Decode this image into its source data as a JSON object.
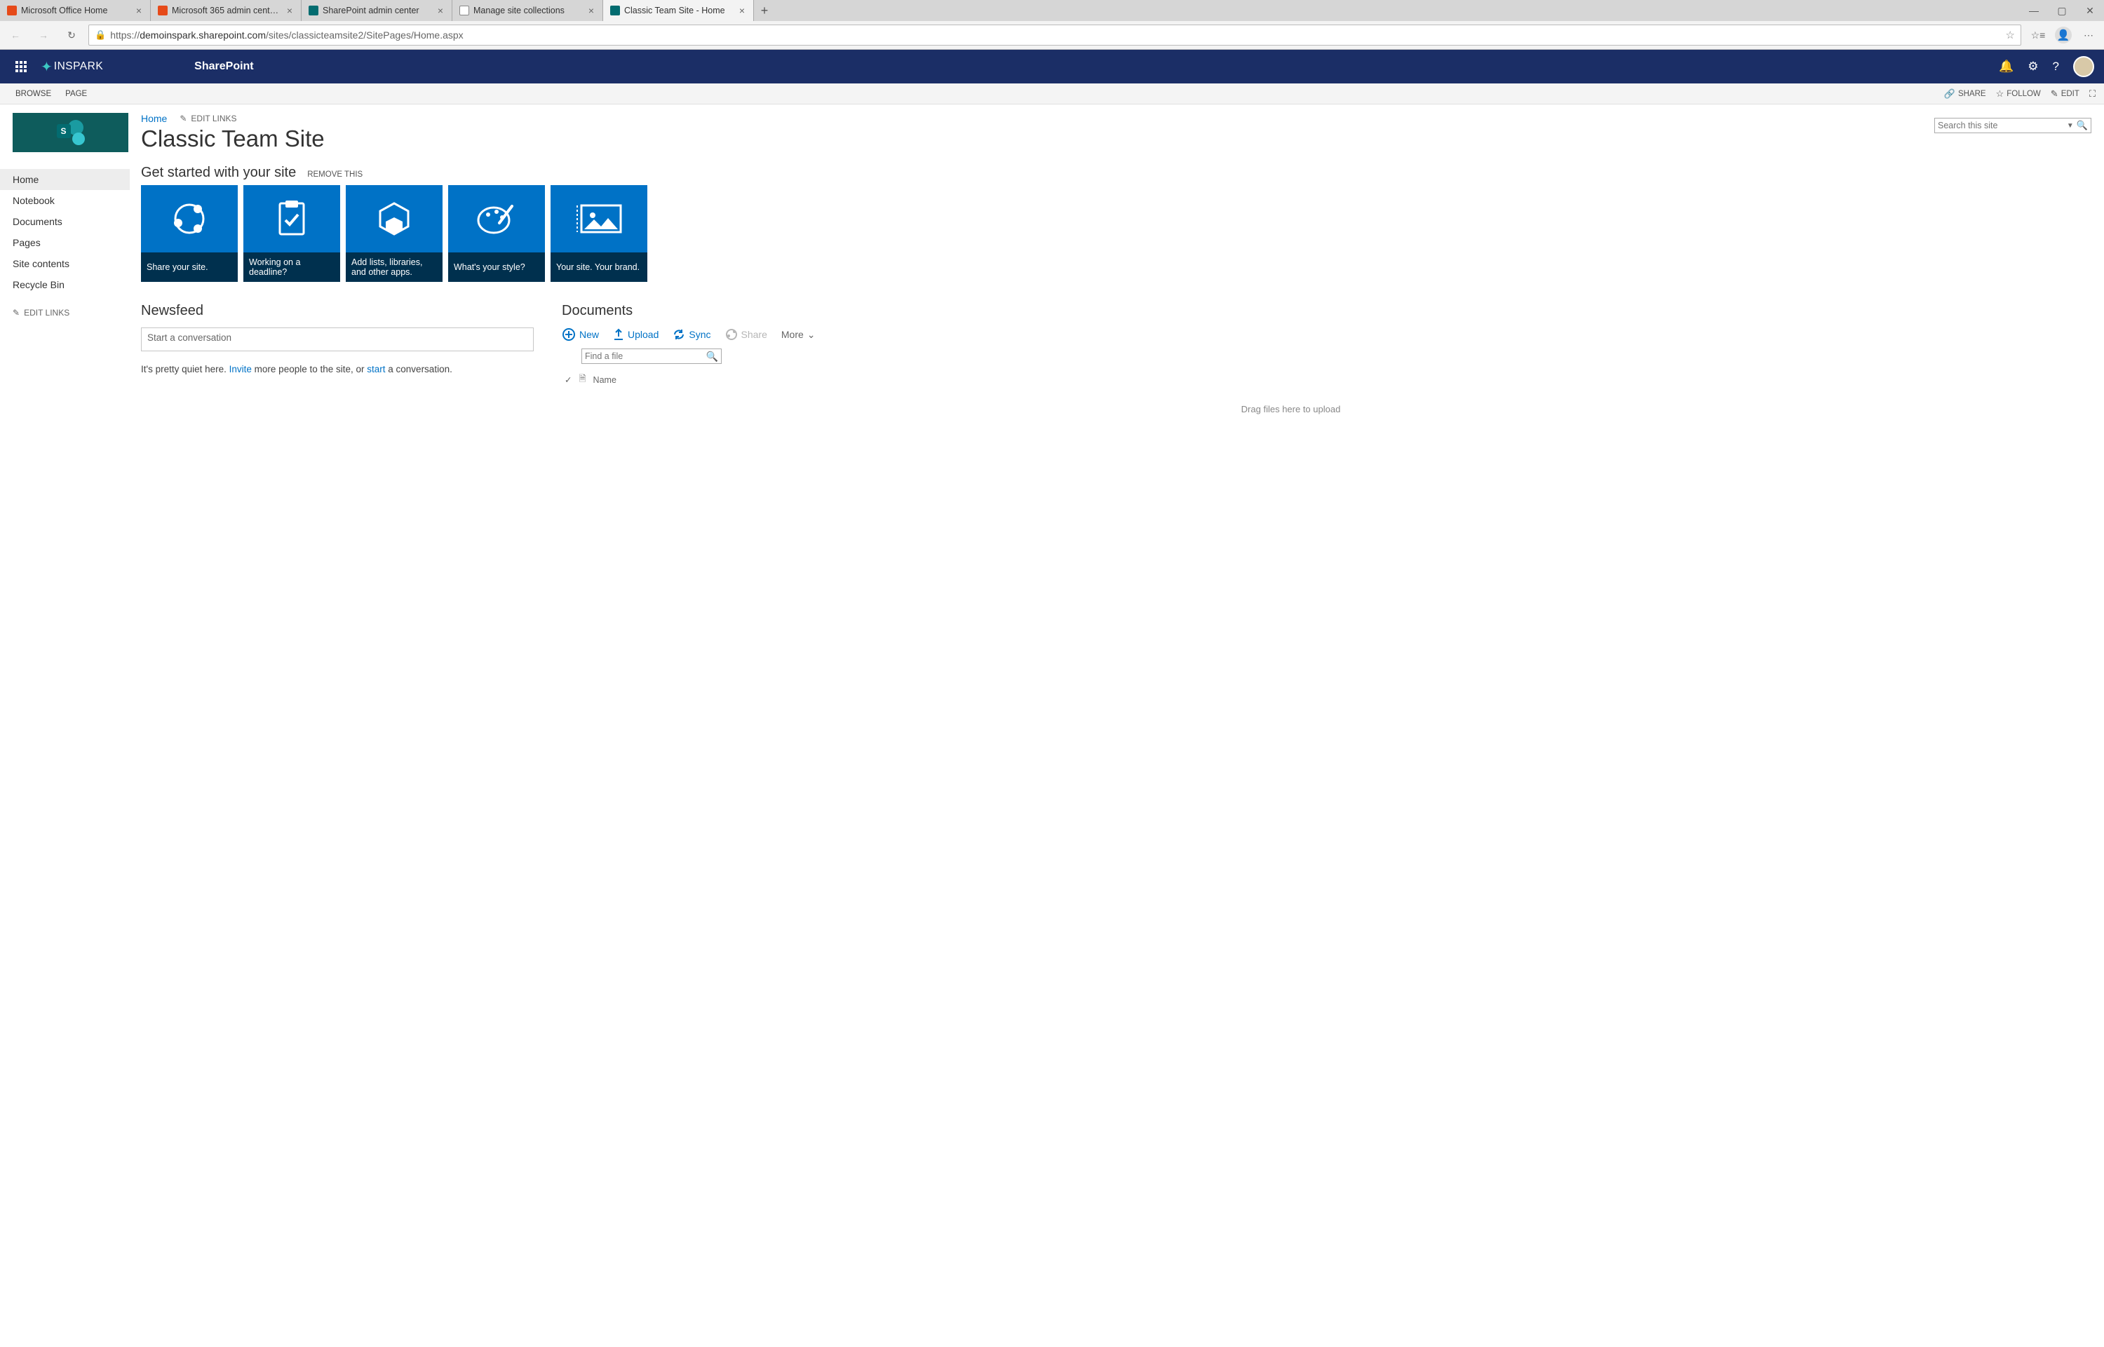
{
  "browser": {
    "tabs": [
      {
        "title": "Microsoft Office Home",
        "favicon": "office"
      },
      {
        "title": "Microsoft 365 admin center - M…",
        "favicon": "office"
      },
      {
        "title": "SharePoint admin center",
        "favicon": "sp"
      },
      {
        "title": "Manage site collections",
        "favicon": "doc"
      },
      {
        "title": "Classic Team Site - Home",
        "favicon": "sp",
        "active": true
      }
    ],
    "url_prefix": "https://",
    "url_host": "demoinspark.sharepoint.com",
    "url_path": "/sites/classicteamsite2/SitePages/Home.aspx"
  },
  "suite": {
    "brand": "INSPARK",
    "product": "SharePoint"
  },
  "ribbon": {
    "browse": "BROWSE",
    "page": "PAGE",
    "share": "SHARE",
    "follow": "FOLLOW",
    "edit": "EDIT"
  },
  "breadcrumb": {
    "home": "Home",
    "edit_links": "EDIT LINKS"
  },
  "page_title": "Classic Team Site",
  "search_placeholder": "Search this site",
  "quicklaunch": {
    "items": [
      "Home",
      "Notebook",
      "Documents",
      "Pages",
      "Site contents",
      "Recycle Bin"
    ],
    "edit_links": "EDIT LINKS"
  },
  "get_started": {
    "title": "Get started with your site",
    "remove": "REMOVE THIS",
    "tiles": [
      {
        "label": "Share your site."
      },
      {
        "label": "Working on a deadline?"
      },
      {
        "label": "Add lists, libraries, and other apps."
      },
      {
        "label": "What's your style?"
      },
      {
        "label": "Your site. Your brand."
      }
    ]
  },
  "newsfeed": {
    "title": "Newsfeed",
    "placeholder": "Start a conversation",
    "quiet_pre": "It's pretty quiet here. ",
    "invite": "Invite",
    "quiet_mid": " more people to the site, or ",
    "start": "start",
    "quiet_post": " a conversation."
  },
  "documents": {
    "title": "Documents",
    "new": "New",
    "upload": "Upload",
    "sync": "Sync",
    "share": "Share",
    "more": "More",
    "find_placeholder": "Find a file",
    "col_name": "Name",
    "drag_hint": "Drag files here to upload"
  }
}
